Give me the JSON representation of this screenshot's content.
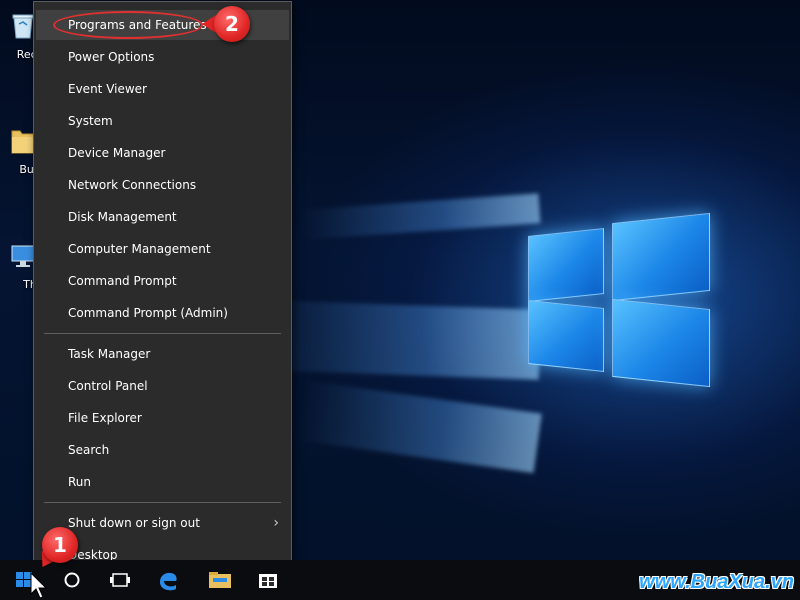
{
  "desktop_icons": [
    {
      "label": "Recy"
    },
    {
      "label": "Bua"
    },
    {
      "label": "Th"
    }
  ],
  "menu": {
    "group1": [
      {
        "label": "Programs and Features"
      },
      {
        "label": "Power Options"
      },
      {
        "label": "Event Viewer"
      },
      {
        "label": "System"
      },
      {
        "label": "Device Manager"
      },
      {
        "label": "Network Connections"
      },
      {
        "label": "Disk Management"
      },
      {
        "label": "Computer Management"
      },
      {
        "label": "Command Prompt"
      },
      {
        "label": "Command Prompt (Admin)"
      }
    ],
    "group2": [
      {
        "label": "Task Manager"
      },
      {
        "label": "Control Panel"
      },
      {
        "label": "File Explorer"
      },
      {
        "label": "Search"
      },
      {
        "label": "Run"
      }
    ],
    "group3": [
      {
        "label": "Shut down or sign out",
        "submenu_arrow": "›"
      },
      {
        "label": "Desktop"
      }
    ]
  },
  "callouts": {
    "step1": "1",
    "step2": "2"
  },
  "watermark": "www.BuaXua.vn",
  "colors": {
    "menu_bg": "#2b2b2b",
    "menu_highlight": "#404040",
    "callout_red": "#e02525",
    "taskbar": "#0b0c10",
    "windows_blue": "#2a8ce8",
    "watermark": "#2ea6ff"
  },
  "icons": [
    "recycle-bin-icon",
    "folder-icon",
    "this-pc-icon",
    "windows-start-icon",
    "cortana-icon",
    "task-view-icon",
    "edge-icon",
    "file-explorer-icon",
    "store-icon",
    "mouse-cursor-icon"
  ]
}
